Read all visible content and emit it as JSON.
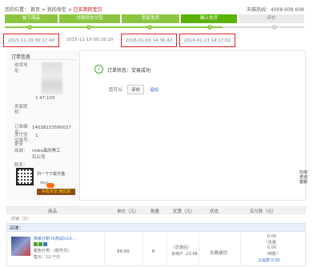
{
  "breadcrumb": {
    "location_label": "您的位置：",
    "home": "首页",
    "my_taobao": "我的淘宝",
    "current": "已买到的宝贝"
  },
  "hotline": "天猫热线：4008 608 608",
  "steps": [
    {
      "label": "拍下商品",
      "state": "done"
    },
    {
      "label": "付款到支付宝",
      "state": "done"
    },
    {
      "label": "卖家发货",
      "state": "done"
    },
    {
      "label": "确认收货",
      "state": "current"
    },
    {
      "label": "评价",
      "state": "pending"
    }
  ],
  "step_dots": [
    "1",
    "2",
    "3",
    "4",
    "5"
  ],
  "timestamps": [
    {
      "text": "2015-11-19 00:17:40",
      "boxed": true
    },
    {
      "text": "2015-11-19 00:18:10",
      "boxed": false
    },
    {
      "text": "2016-01-03 14:36:42",
      "boxed": true
    },
    {
      "text": "2016-01-13 14:17:02",
      "boxed": true
    }
  ],
  "order_info": {
    "title": "订单信息",
    "labels": {
      "address": "收货地\n址：",
      "seller": "卖家昵\n称：",
      "order_no": "订单编\n号：",
      "ali": "支付宝\n交易号：",
      "mall": "商城：",
      "more": "更多",
      "contact": "联系："
    },
    "values": {
      "seller_partial": "1 47,103",
      "order_no": "14038153580027",
      "ali_partial": "1",
      "mall_line1": "rolex森的黑工",
      "mall_line2": "石公司"
    },
    "qr": {
      "text": "扫一下下载天猫",
      "app": "App",
      "badge": "手机专享 满优惠"
    }
  },
  "status": {
    "icon": "check-circle-icon",
    "label": "订单状态：",
    "value": "交易成功"
  },
  "actions": {
    "prefix": "您可以",
    "review": "评价",
    "other": "追加"
  },
  "side_float": "在线咨询客服",
  "table": {
    "headers": [
      "商品",
      "单价（元）",
      "数量",
      "优惠（元）",
      "状态",
      "实付款（元）"
    ],
    "sub_left": "店铺（元）",
    "seller_row": "店铺：",
    "item": {
      "title": "高级订制 ht测试in10...",
      "sub": "颜色分类：(收件方)",
      "sub2": "售价：12.**元",
      "price": "99.00",
      "qty": "6",
      "discount_line1": "（优惠后）",
      "discount_line2": "多用户 -23.08",
      "status": "交易成功",
      "total_line1": "0.00",
      "total_line2": "（优惠",
      "total_line3": "0.00",
      "total_line4": "（到账）",
      "total_foot": "以运费 0.00"
    }
  }
}
